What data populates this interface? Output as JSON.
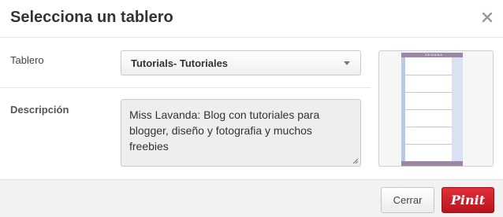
{
  "dialog": {
    "title": "Selecciona un tablero",
    "close_icon": "close-icon"
  },
  "board": {
    "label": "Tablero",
    "selected": "Tutorials- Tutoriales",
    "dropdown_icon": "chevron-down-icon"
  },
  "description": {
    "label": "Descripción",
    "value": "Miss Lavanda: Blog con tutoriales para blogger, diseño y fotografia y muchos freebies"
  },
  "preview": {
    "header_text": "SEMANA",
    "colors": {
      "bar": "#9a87a8",
      "left_column": "#b7c8e8",
      "right_column": "#d9e1f2"
    }
  },
  "footer": {
    "cancel_label": "Cerrar",
    "pin_label": "Pinit"
  },
  "colors": {
    "pin_button": "#cb2027",
    "footer_background": "#f2f2f2",
    "textarea_background": "#eeeeee"
  }
}
